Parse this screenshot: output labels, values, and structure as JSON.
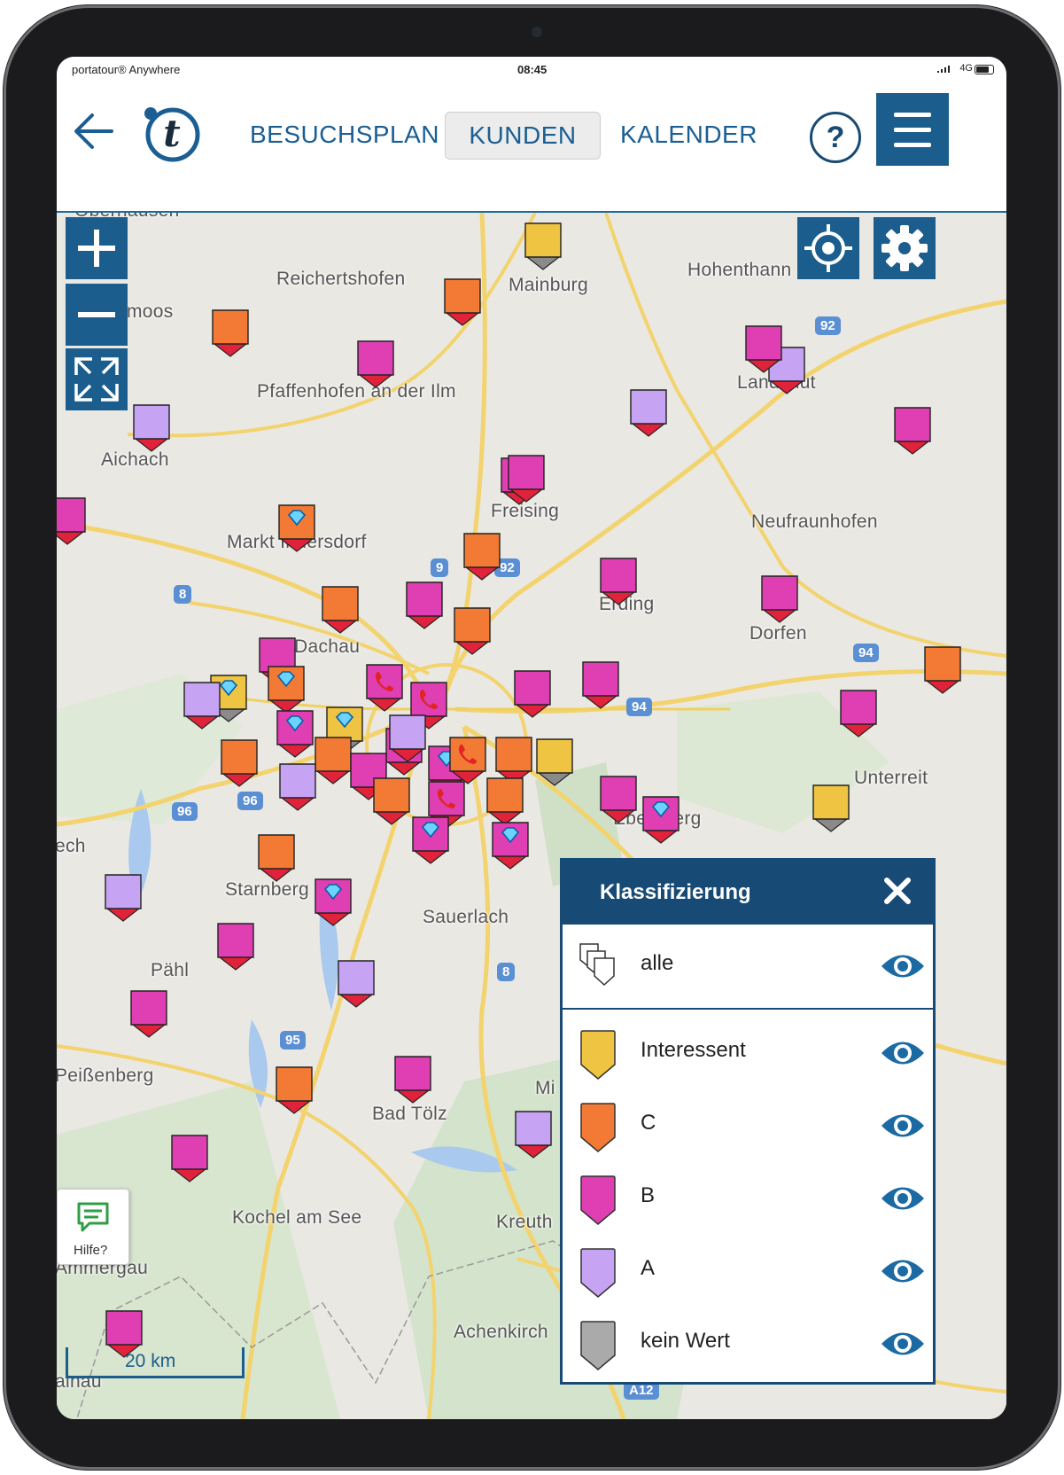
{
  "status": {
    "app": "portatour® Anywhere",
    "time": "08:45",
    "network": "4G"
  },
  "nav": {
    "tabs": [
      {
        "label": "BESUCHSPLAN"
      },
      {
        "label": "KUNDEN",
        "active": true
      },
      {
        "label": "KALENDER"
      }
    ],
    "help_label": "?"
  },
  "map": {
    "places": [
      "Oberhausen",
      "Reichertshofen",
      "Mainburg",
      "Hohenthann",
      "Klingsmoos",
      "Pfaffenhofen an der Ilm",
      "Landshut",
      "Aichach",
      "Freising",
      "Neufraunhofen",
      "Markt Indersdorf",
      "Erding",
      "Dorfen",
      "Dachau",
      "Unterreit",
      "Ebersberg",
      "Starnberg",
      "Sauerlach",
      "Pähl",
      "Peißenberg",
      "Bad Tölz",
      "Kochel am See",
      "Kreuth",
      "Achenkirch",
      "Ammergau",
      "Mi",
      "ech",
      "ainau"
    ],
    "roads": [
      "92",
      "9",
      "92",
      "8",
      "94",
      "94",
      "96",
      "96",
      "8",
      "95",
      "A12"
    ],
    "scale_label": "20 km",
    "controls": {
      "zoom_in": "+",
      "zoom_out": "−"
    }
  },
  "colors": {
    "interessent": "#efc442",
    "c": "#f27a34",
    "b": "#df3fb2",
    "a": "#c6a3f3",
    "kein_wert": "#aaaaaa",
    "brand": "#174a74"
  },
  "legend": {
    "title": "Klassifizierung",
    "items": [
      {
        "label": "alle",
        "color": "#ffffff",
        "visible": true
      },
      {
        "label": "Interessent",
        "color": "#efc442",
        "visible": true
      },
      {
        "label": "C",
        "color": "#f27a34",
        "visible": true
      },
      {
        "label": "B",
        "color": "#df3fb2",
        "visible": true
      },
      {
        "label": "A",
        "color": "#c6a3f3",
        "visible": true
      },
      {
        "label": "kein Wert",
        "color": "#aaaaaa",
        "visible": true
      }
    ]
  },
  "help_widget": {
    "label": "Hilfe?"
  }
}
